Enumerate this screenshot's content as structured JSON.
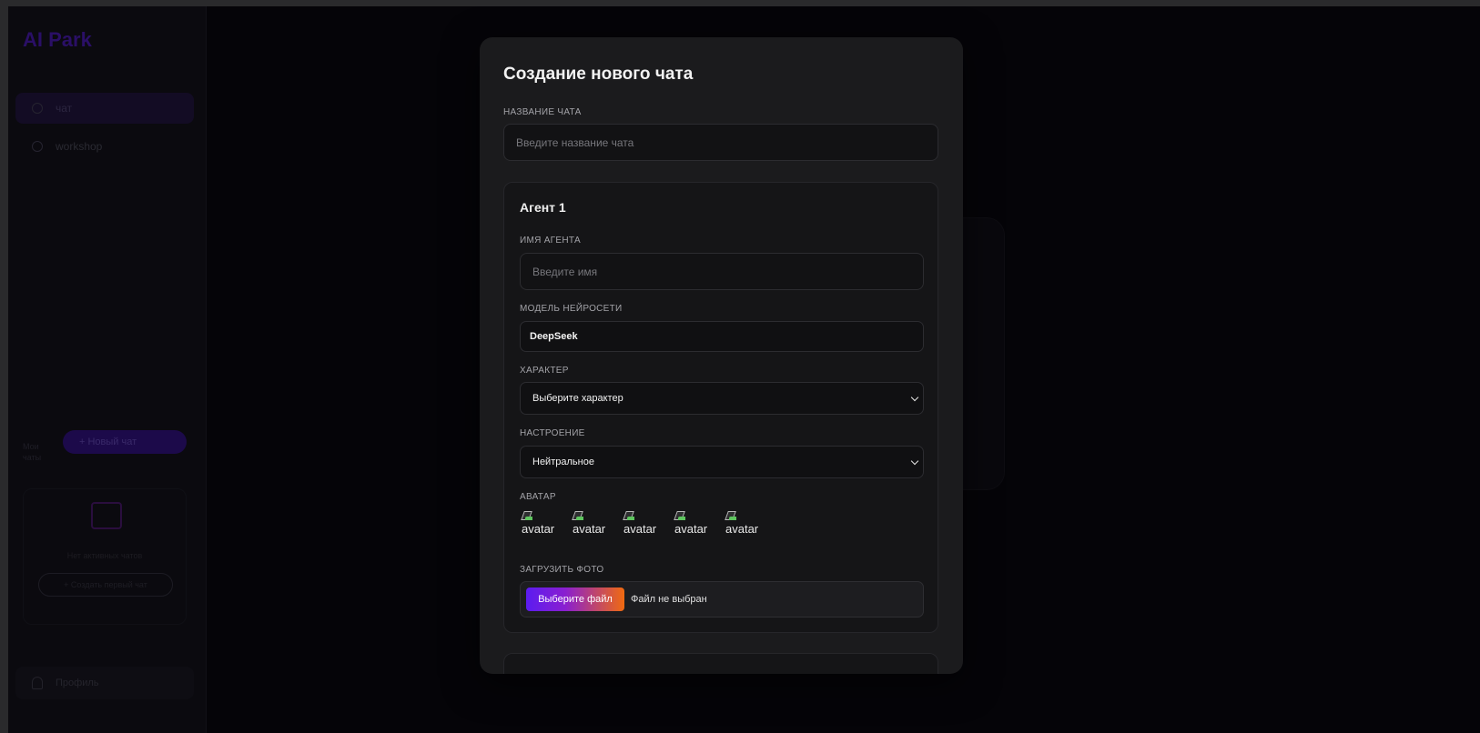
{
  "background": {
    "logo": "AI Park",
    "nav": [
      "чат",
      "workshop"
    ],
    "sort_label": "Мои чаты",
    "new_chat_button": "+ Новый чат",
    "empty_text": "Нет активных чатов",
    "empty_button": "+ Создать первый чат",
    "profile": "Профиль"
  },
  "modal": {
    "title": "Создание нового чата",
    "chat_name_label": "Название чата",
    "chat_name_placeholder": "Введите название чата",
    "agent": {
      "title": "Агент 1",
      "name_label": "Имя агента",
      "name_placeholder": "Введите имя",
      "model_label": "Модель нейросети",
      "model_value": "DeepSeek",
      "character_label": "Характер",
      "character_value": "Выберите характер",
      "mood_label": "Настроение",
      "mood_value": "Нейтральное",
      "avatar_label": "Аватар",
      "avatars": [
        "avatar",
        "avatar",
        "avatar",
        "avatar",
        "avatar"
      ],
      "upload_label": "Загрузить фото",
      "file_button": "Выберите файл",
      "file_status": "Файл не выбран"
    }
  },
  "colors": {
    "accent_start": "#5b1cf0",
    "accent_end": "#f06a10",
    "modal_bg": "#1b1b1d"
  }
}
